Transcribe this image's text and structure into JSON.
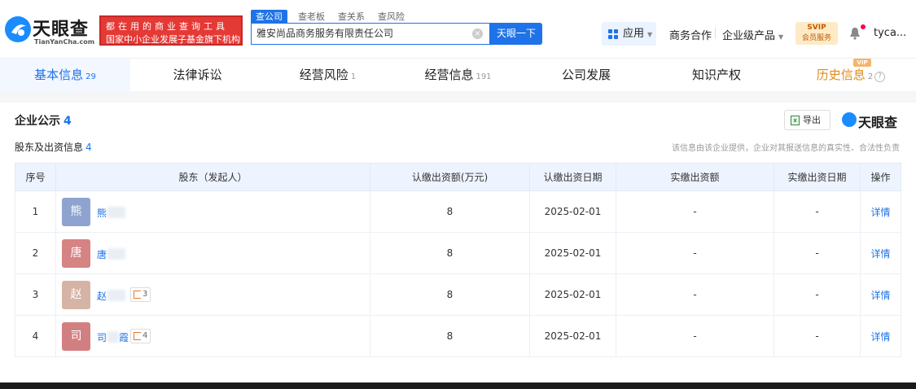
{
  "header": {
    "logo_text": "天眼查",
    "logo_sub": "TianYanCha.com",
    "promo_line1": "都在用的商业查询工具",
    "promo_line2": "国家中小企业发展子基金旗下机构",
    "search_tabs": [
      "查公司",
      "查老板",
      "查关系",
      "查风险"
    ],
    "search_value": "雅安尚品商务服务有限责任公司",
    "search_button": "天眼一下",
    "nav_app": "应用",
    "nav_business": "商务合作",
    "nav_enterprise": "企业级产品",
    "svip_top": "SVIP",
    "svip_bottom": "会员服务",
    "user": "tyca..."
  },
  "tabs": [
    {
      "label": "基本信息",
      "count": "29"
    },
    {
      "label": "法律诉讼",
      "count": ""
    },
    {
      "label": "经营风险",
      "count": "1"
    },
    {
      "label": "经营信息",
      "count": "191"
    },
    {
      "label": "公司发展",
      "count": ""
    },
    {
      "label": "知识产权",
      "count": ""
    },
    {
      "label": "历史信息",
      "count": "2"
    }
  ],
  "vip_badge": "VIP",
  "section": {
    "title": "企业公示",
    "title_count": "4",
    "export_label": "导出",
    "brand": "天眼查",
    "subtitle": "股东及出资信息",
    "subtitle_count": "4",
    "disclaimer": "该信息由该企业提供，企业对其报送信息的真实性、合法性负责"
  },
  "table": {
    "headers": [
      "序号",
      "股东（发起人）",
      "认缴出资额(万元)",
      "认缴出资日期",
      "实缴出资额",
      "实缴出资日期",
      "操作"
    ],
    "rows": [
      {
        "index": "1",
        "avatar": "熊",
        "avatar_color": "#8ea3cf",
        "name": "熊",
        "badge": "",
        "amount": "8",
        "date": "2025-02-01",
        "paid": "-",
        "paid_date": "-",
        "action": "详情"
      },
      {
        "index": "2",
        "avatar": "唐",
        "avatar_color": "#d58383",
        "name": "唐",
        "badge": "",
        "amount": "8",
        "date": "2025-02-01",
        "paid": "-",
        "paid_date": "-",
        "action": "详情"
      },
      {
        "index": "3",
        "avatar": "赵",
        "avatar_color": "#d5b4a5",
        "name": "赵",
        "badge": "3",
        "amount": "8",
        "date": "2025-02-01",
        "paid": "-",
        "paid_date": "-",
        "action": "详情"
      },
      {
        "index": "4",
        "avatar": "司",
        "avatar_color": "#d27f82",
        "name": "司",
        "name_suffix": "霞",
        "badge": "4",
        "amount": "8",
        "date": "2025-02-01",
        "paid": "-",
        "paid_date": "-",
        "action": "详情"
      }
    ]
  },
  "colors": {
    "accent": "#1e73e8",
    "promo_red": "#e53935",
    "history_orange": "#e08a1a"
  }
}
